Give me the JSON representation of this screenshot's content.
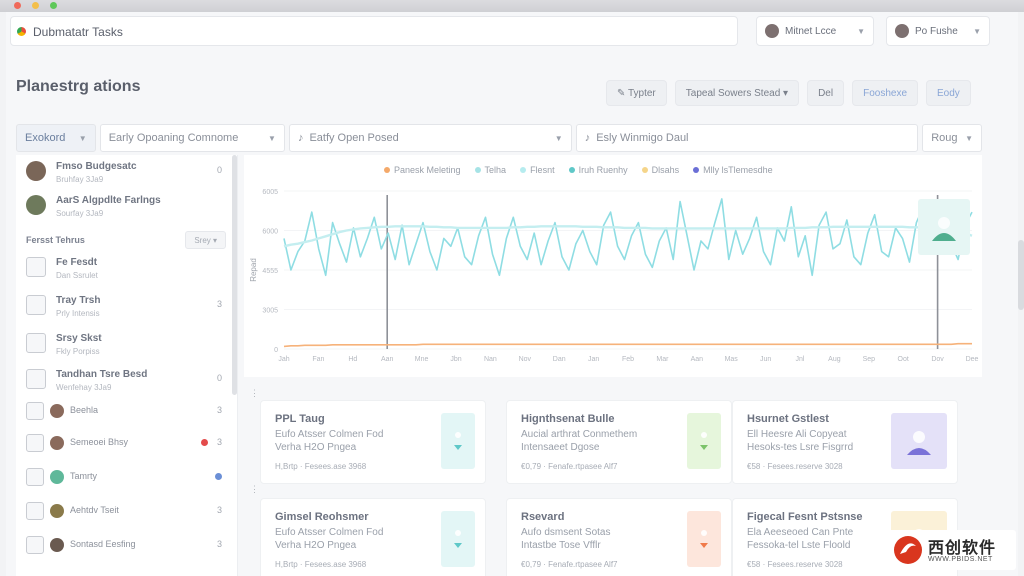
{
  "window": {
    "title": ""
  },
  "search": {
    "value": "Dubmatatr Tasks"
  },
  "users": [
    {
      "label": "Mitnet Lcce"
    },
    {
      "label": "Po Fushe"
    }
  ],
  "page": {
    "title": "Planestrg ations"
  },
  "actions": [
    {
      "label": "✎ Typter"
    },
    {
      "label": "Tapeal Sowers Stead ▾"
    },
    {
      "label": "Del"
    },
    {
      "label": "Fooshexe"
    },
    {
      "label": "Eody"
    }
  ],
  "filters": [
    {
      "label": "Exokord"
    },
    {
      "label": "Early Opoaning Comnome"
    },
    {
      "label": "Eatfy Open Posed"
    },
    {
      "label": "Esly Winmigo Daul"
    },
    {
      "label": "Roug"
    }
  ],
  "sidebar": {
    "contacts": [
      {
        "name": "Fmso Budgesatc",
        "sub": "Bruhfay 3Ja9",
        "count": "0"
      },
      {
        "name": "AarS Algpdlte Farlngs",
        "sub": "Sourfay 3Ja9",
        "count": ""
      }
    ],
    "section": {
      "label": "Fersst Tehrus",
      "sort": "Srey ▾"
    },
    "items": [
      {
        "name": "Fe Fesdt",
        "sub": "Dan Ssrulet",
        "count": ""
      },
      {
        "name": "Tray Trsh",
        "sub": "Prly Intensis",
        "count": "3"
      },
      {
        "name": "Srsy Skst",
        "sub": "Fkly Porpiss",
        "count": ""
      },
      {
        "name": "Tandhan Tsre Besd",
        "sub": "Wenfehay 3Ja9",
        "count": "0"
      }
    ],
    "minis": [
      {
        "name": "Beehla",
        "count": "3",
        "badge": ""
      },
      {
        "name": "Semeoei Bhsy",
        "count": "3",
        "badge": "#e34b4b"
      },
      {
        "name": "Tamrty",
        "count": "",
        "badge": "#6b8fd6"
      },
      {
        "name": "Aehtdv Tseit",
        "count": "3",
        "badge": ""
      },
      {
        "name": "Sontasd Eesfing",
        "count": "3",
        "badge": ""
      }
    ]
  },
  "chart_data": {
    "type": "line",
    "legend": [
      {
        "name": "Panesk Meleting",
        "color": "#f4a96a"
      },
      {
        "name": "Telha",
        "color": "#a6e3e6"
      },
      {
        "name": "Flesnt",
        "color": "#b6ecef"
      },
      {
        "name": "Iruh Ruenhy",
        "color": "#5fc8c8"
      },
      {
        "name": "Dlsahs",
        "color": "#f5d58a"
      },
      {
        "name": "Mlly lsTlemesdhe",
        "color": "#6b6fd6"
      }
    ],
    "ylabel": "Repad",
    "yticks": [
      "6005",
      "6000",
      "4555",
      "3005",
      "0"
    ],
    "xticks": [
      "Jah",
      "Fan",
      "Hd",
      "Aan",
      "Mne",
      "Jbn",
      "Nan",
      "Nov",
      "Dan",
      "Jan",
      "Feb",
      "Mar",
      "Aan",
      "Mas",
      "Jun",
      "Jnl",
      "Aug",
      "Sep",
      "Oot",
      "Dov",
      "Dee"
    ],
    "series": [
      {
        "name": "Telha",
        "color": "#8fdde3",
        "values": [
          210,
          150,
          185,
          205,
          260,
          190,
          140,
          240,
          200,
          165,
          230,
          175,
          210,
          250,
          190,
          220,
          170,
          235,
          160,
          200,
          240,
          185,
          150,
          210,
          195,
          230,
          175,
          160,
          215,
          250,
          180,
          140,
          210,
          250,
          195,
          170,
          220,
          160,
          205,
          240,
          175,
          150,
          200,
          225,
          185,
          160,
          235,
          260,
          195,
          170,
          215,
          240,
          180,
          155,
          205,
          230,
          170,
          280,
          215,
          150,
          205,
          190,
          240,
          285,
          170,
          225,
          180,
          210,
          250,
          185,
          160,
          230,
          205,
          270,
          175,
          215,
          140,
          235,
          260,
          190,
          200,
          245,
          175,
          160,
          220,
          255,
          185,
          175,
          230,
          210,
          165,
          240,
          270,
          185,
          215,
          250,
          200,
          170,
          235,
          260
        ]
      },
      {
        "name": "Flesnt",
        "color": "#c4eef0",
        "values": [
          195,
          198,
          200,
          203,
          206,
          210,
          214,
          218,
          222,
          225,
          227,
          229,
          230,
          231,
          232,
          232,
          233,
          233,
          233,
          233,
          233,
          232,
          232,
          231,
          231,
          230,
          230,
          230,
          230,
          230,
          230,
          230,
          230,
          231,
          231,
          232,
          232,
          233,
          233,
          233,
          233,
          233,
          233,
          232,
          232,
          232,
          231,
          231,
          231,
          230,
          230,
          230,
          230,
          229,
          229,
          229,
          229,
          229,
          229,
          229,
          229,
          229,
          229,
          229,
          229,
          229,
          229,
          229,
          229,
          229,
          229,
          229,
          229,
          230,
          230,
          230,
          231,
          231,
          231,
          232,
          232,
          232,
          232,
          232,
          232,
          232,
          232,
          232,
          232,
          232,
          231,
          231,
          231,
          230,
          230,
          229,
          228,
          225,
          220,
          215
        ]
      },
      {
        "name": "Panesk Meleting",
        "color": "#f6b27a",
        "values": [
          5,
          6,
          6,
          7,
          7,
          7,
          7,
          8,
          8,
          8,
          8,
          8,
          8,
          8,
          8,
          8,
          8,
          8,
          8,
          8,
          9,
          9,
          9,
          9,
          9,
          9,
          9,
          9,
          9,
          9,
          9,
          9,
          9,
          9,
          9,
          9,
          9,
          9,
          9,
          9,
          9,
          9,
          9,
          9,
          9,
          9,
          9,
          9,
          9,
          9,
          9,
          9,
          9,
          9,
          9,
          9,
          9,
          9,
          9,
          9,
          9,
          9,
          9,
          9,
          9,
          9,
          9,
          9,
          9,
          9,
          9,
          9,
          9,
          9,
          9,
          9,
          9,
          9,
          9,
          9,
          9,
          9,
          9,
          9,
          9,
          9,
          9,
          9,
          9,
          9,
          9,
          9,
          9,
          9,
          9,
          9,
          9,
          10,
          10,
          10
        ]
      }
    ],
    "ylim": [
      0,
      300
    ],
    "markers": [
      "Aan",
      "Dov"
    ]
  },
  "cards": [
    {
      "title": "PPL Taug",
      "line1": "Eufo Atsser Colmen Fod",
      "line2": "Verha H2O Pngea",
      "meta": "H,Brtp  ·  Fesees.ase 3968",
      "thumb": "#e3f6f6",
      "mark": "#5fc8c8",
      "big": false
    },
    {
      "title": "Hignthsenat Bulle",
      "line1": "Aucial arthrat Conmethem",
      "line2": "Intensaeet Dgose",
      "meta": "€0,79  ·  Fenafe.rtpasee Alf7",
      "thumb": "#e6f6dc",
      "mark": "#7cc36a",
      "big": false
    },
    {
      "title": "Hsurnet Gstlest",
      "line1": "Ell Heesre Ali Copyeat",
      "line2": "Hesoks-tes Lsre Fisgrrd",
      "meta": "€58  ·  Fesees.reserve 3028",
      "thumb": "#e4e1f8",
      "mark": "#7a72d8",
      "big": true
    },
    {
      "title": "Gimsel Reohsmer",
      "line1": "Eufo Atsser Colmen Fod",
      "line2": "Verha H2O Pngea",
      "meta": "H,Brtp  ·  Fesees.ase 3968",
      "thumb": "#e3f6f6",
      "mark": "#5fc8c8",
      "big": false
    },
    {
      "title": "Rsevard",
      "line1": "Aufo dsmsent Sotas",
      "line2": "Intastbe Tose Vfflr",
      "meta": "€0,79  ·  Fenafe.rtpasee Alf7",
      "thumb": "#fde6dc",
      "mark": "#f07a4a",
      "big": false
    },
    {
      "title": "Figecal Fesnt Pstsnse",
      "line1": "Ela Aeeseoed Can Pnte",
      "line2": "Fessoka-tel Lste Floold",
      "meta": "€58  ·  Fesees.reserve 3028",
      "thumb": "#fbf1d8",
      "mark": "#e8b840",
      "big": true
    }
  ],
  "watermark": {
    "cn": "西创软件",
    "url": "WWW.PBIDS.NET"
  }
}
